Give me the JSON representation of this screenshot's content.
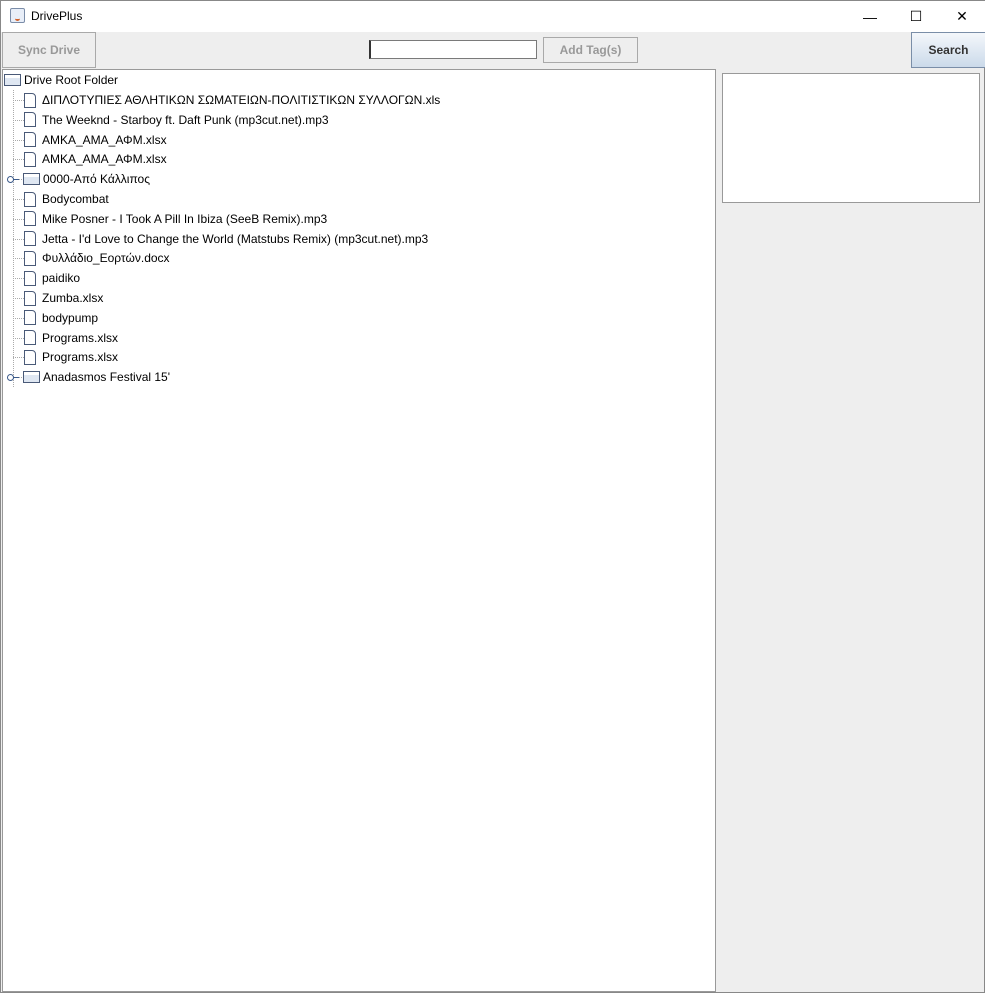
{
  "window": {
    "title": "DrivePlus",
    "minimize": "—",
    "maximize": "☐",
    "close": "✕"
  },
  "toolbar": {
    "sync_label": "Sync Drive",
    "tag_input_value": "",
    "add_tags_label": "Add Tag(s)",
    "search_label": "Search"
  },
  "tree": {
    "root": "Drive Root Folder",
    "items": [
      {
        "label": "ΔΙΠΛΟΤΥΠΙΕΣ ΑΘΛΗΤΙΚΩΝ ΣΩΜΑΤΕΙΩΝ-ΠΟΛΙΤΙΣΤΙΚΩΝ ΣΥΛΛΟΓΩΝ.xls",
        "type": "file"
      },
      {
        "label": "The Weeknd - Starboy ft. Daft Punk (mp3cut.net).mp3",
        "type": "file"
      },
      {
        "label": "ΑΜΚΑ_ΑΜΑ_ΑΦΜ.xlsx",
        "type": "file"
      },
      {
        "label": "ΑΜΚΑ_ΑΜΑ_ΑΦΜ.xlsx",
        "type": "file"
      },
      {
        "label": "0000-Από Κάλλιπος",
        "type": "folder"
      },
      {
        "label": "Bodycombat",
        "type": "file"
      },
      {
        "label": "Mike Posner - I Took A Pill In Ibiza (SeeB Remix).mp3",
        "type": "file"
      },
      {
        "label": "Jetta - I'd Love to Change the World (Matstubs Remix) (mp3cut.net).mp3",
        "type": "file"
      },
      {
        "label": "Φυλλάδιο_Εορτών.docx",
        "type": "file"
      },
      {
        "label": "paidiko",
        "type": "file"
      },
      {
        "label": "Zumba.xlsx",
        "type": "file"
      },
      {
        "label": "bodypump",
        "type": "file"
      },
      {
        "label": "Programs.xlsx",
        "type": "file"
      },
      {
        "label": "Programs.xlsx",
        "type": "file"
      },
      {
        "label": "Anadasmos Festival 15'",
        "type": "folder"
      }
    ]
  }
}
